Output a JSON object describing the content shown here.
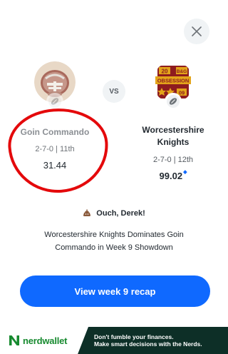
{
  "close": {
    "icon": "close-icon"
  },
  "matchup": {
    "vs_label": "VS",
    "left_team": {
      "name": "Goin Commando",
      "record": "2-7-0 | 11th",
      "score": "31.44",
      "avatar_icon": "helmet-avatar-icon",
      "badge_icon": "football-icon"
    },
    "right_team": {
      "name": "Worcestershire Knights",
      "record": "2-7-0 | 12th",
      "score": "99.02",
      "score_indicator_icon": "projection-spark-icon",
      "avatar_icon": "obsession-logo-avatar-icon",
      "logo_text": {
        "top_left": "20",
        "top_right": "B&G",
        "banner": "OBSESSION",
        "bottom": "09"
      },
      "badge_icon": "football-icon"
    }
  },
  "reaction": {
    "emoji_icon": "poop-emoji-icon",
    "text": "Ouch, Derek!"
  },
  "headline": "Worcestershire Knights Dominates Goin Commando in Week 9 Showdown",
  "recap_button": {
    "label": "View week 9 recap"
  },
  "ad": {
    "brand": "nerdwallet",
    "logo_icon": "nerdwallet-n-icon",
    "line1": "Don't fumble your finances.",
    "line2": "Make smart decisions with the Nerds."
  },
  "colors": {
    "primary_button": "#0f69ff",
    "annotation_circle": "#e4090b",
    "ad_background": "#0d2f27",
    "ad_brand": "#178a2f"
  }
}
